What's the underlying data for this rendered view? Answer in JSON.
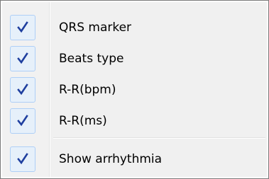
{
  "menu": {
    "items": [
      {
        "label": "QRS marker",
        "checked": true
      },
      {
        "label": "Beats type",
        "checked": true
      },
      {
        "label": "R-R(bpm)",
        "checked": true
      },
      {
        "label": "R-R(ms)",
        "checked": true
      }
    ],
    "extra_items": [
      {
        "label": "Show arrhythmia",
        "checked": true
      }
    ],
    "check_icon": "checkmark-icon",
    "colors": {
      "check": "#1f3f9f",
      "check_bg": "#e6f0fa",
      "check_border": "#aecff7"
    }
  }
}
